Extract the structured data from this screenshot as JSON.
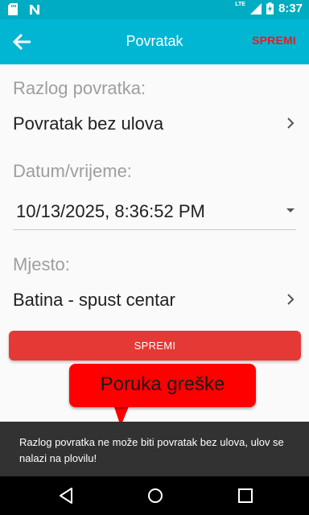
{
  "status_bar": {
    "time": "8:37",
    "network": "LTE",
    "battery_icon": "battery-charging-icon",
    "left_icons": [
      "sd-card-icon",
      "notification-n-icon"
    ]
  },
  "app_bar": {
    "title": "Povratak",
    "save_label": "SPREMI",
    "back_icon": "arrow-back-icon",
    "bg_color": "#00b6d3",
    "save_color": "#e31e24"
  },
  "form": {
    "reason_label": "Razlog povratka:",
    "reason_value": "Povratak bez ulova",
    "datetime_label": "Datum/vrijeme:",
    "datetime_value": "10/13/2025, 8:36:52 PM",
    "location_label": "Mjesto:",
    "location_value": "Batina - spust centar"
  },
  "primary_button": {
    "label": "SPREMI",
    "color": "#e53935"
  },
  "callout": {
    "text": "Poruka greške"
  },
  "snackbar": {
    "message": "Razlog povratka ne može biti povratak bez ulova, ulov se nalazi na plovilu!"
  },
  "nav_bar": {
    "icons": [
      "back-triangle-icon",
      "home-circle-icon",
      "recents-square-icon"
    ]
  }
}
